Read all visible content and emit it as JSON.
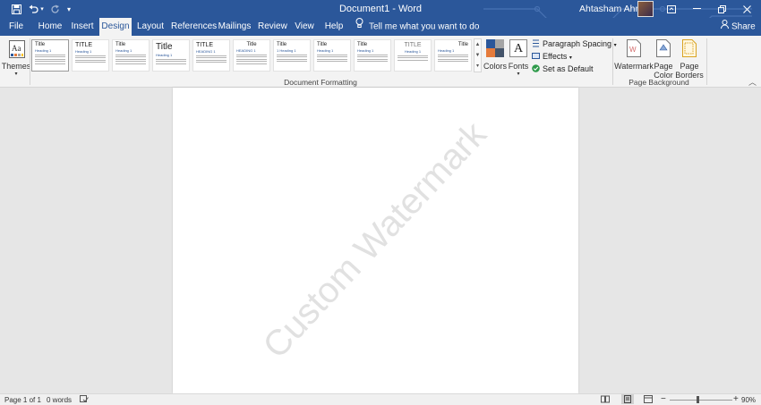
{
  "titlebar": {
    "doc_title": "Document1  -  Word",
    "user_name": "Ahtasham Ahmad",
    "quick_access": {
      "save": "save-icon",
      "undo": "undo-icon",
      "undo_dropdown": "chevron-down-icon",
      "redo": "redo-icon",
      "customize": "customize-icon"
    }
  },
  "tabs": [
    {
      "label": "File"
    },
    {
      "label": "Home"
    },
    {
      "label": "Insert"
    },
    {
      "label": "Design"
    },
    {
      "label": "Layout"
    },
    {
      "label": "References"
    },
    {
      "label": "Mailings"
    },
    {
      "label": "Review"
    },
    {
      "label": "View"
    },
    {
      "label": "Help"
    }
  ],
  "tell_me": "Tell me what you want to do",
  "share": "Share",
  "ribbon": {
    "themes_label": "Themes",
    "style_thumbs": [
      {
        "title": "Title",
        "heading": "Heading 1"
      },
      {
        "title": "TITLE",
        "heading": "Heading 1"
      },
      {
        "title": "Title",
        "heading": "Heading 1"
      },
      {
        "title": "Title",
        "heading": "Heading 1"
      },
      {
        "title": "TITLE",
        "heading": "HEADING 1"
      },
      {
        "title": "Title",
        "heading": "HEADING 1"
      },
      {
        "title": "Title",
        "heading": "1 Heading 1"
      },
      {
        "title": "Title",
        "heading": "Heading 1"
      },
      {
        "title": "Title",
        "heading": "Heading 1"
      },
      {
        "title": "TITLE",
        "heading": "Heading 1"
      },
      {
        "title": "Title",
        "heading": "Heading 1"
      }
    ],
    "colors_label": "Colors",
    "fonts_label": "Fonts",
    "fonts_glyph": "A",
    "paragraph_spacing": "Paragraph Spacing",
    "effects": "Effects",
    "set_default": "Set as Default",
    "doc_formatting_group": "Document Formatting",
    "watermark_label": "Watermark",
    "page_color_line1": "Page",
    "page_color_line2": "Color",
    "page_borders_line1": "Page",
    "page_borders_line2": "Borders",
    "page_background_group": "Page Background"
  },
  "document": {
    "watermark_text": "Custom Watermark"
  },
  "statusbar": {
    "page": "Page 1 of 1",
    "words": "0 words",
    "zoom": "90%",
    "zoom_level": 0.9
  },
  "colors": {
    "brand": "#2b579a",
    "ribbon_bg": "#f3f3f3",
    "canvas_bg": "#e6e6e6",
    "watermark": "#e1e1e1"
  }
}
